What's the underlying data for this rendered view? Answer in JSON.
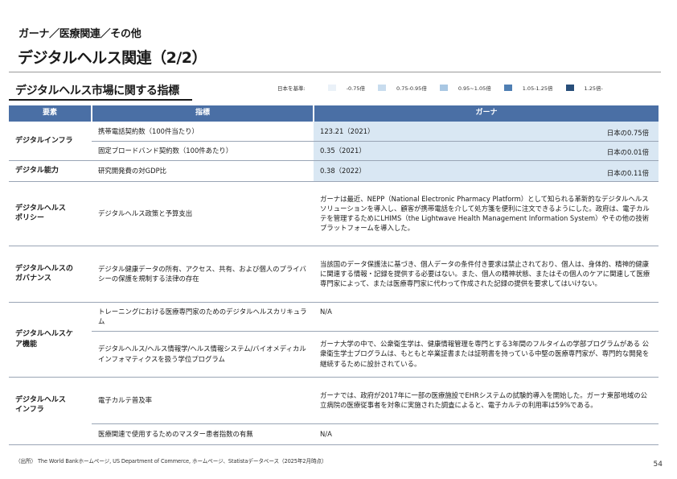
{
  "header": {
    "breadcrumb": "ガーナ／医療関連／その他",
    "title": "デジタルヘルス関連（2/2）",
    "subtitle": "デジタルヘルス市場に関する指標"
  },
  "legend": {
    "label": "日本を基準:",
    "items": [
      {
        "label": "-0.75倍",
        "color": "#eaf1f8"
      },
      {
        "label": "0.75-0.95倍",
        "color": "#c8dcee"
      },
      {
        "label": "0.95~1.05倍",
        "color": "#a9c7e3"
      },
      {
        "label": "1.05-1.25倍",
        "color": "#4f7fb3"
      },
      {
        "label": "1.25倍-",
        "color": "#284e7a"
      }
    ]
  },
  "table": {
    "headers": [
      "要素",
      "指標",
      "ガーナ"
    ],
    "rows": [
      {
        "factor": "デジタルインフラ",
        "indicator": "携帯電話契約数（100件当たり）",
        "ghana": "123.21（2021）",
        "ratio": "日本の0.75倍"
      },
      {
        "indicator": "固定ブロードバンド契約数（100件あたり）",
        "ghana": "0.35（2021）",
        "ratio": "日本の0.01倍"
      },
      {
        "factor": "デジタル能力",
        "indicator": "研究開発費の対GDP比",
        "ghana": "0.38（2022）",
        "ratio": "日本の0.11倍"
      },
      {
        "factor": "デジタルヘルス\nポリシー",
        "indicator": "デジタルヘルス政策と予算支出",
        "ghana": "ガーナは最近、NEPP（National Electronic Pharmacy Platform）として知られる革新的なデジタルヘルスソリューションを導入し、顧客が携帯電話を介して処方箋を便利に注文できるようにした。政府は、電子カルテを管理するためにLHIMS（the Lightwave Health Management Information System）やその他の技術プラットフォームを導入した。"
      },
      {
        "factor": "デジタルヘルスの\nガバナンス",
        "indicator": "デジタル健康データの所有、アクセス、共有、および個人のプライバシーの保護を規制する法律の存在",
        "ghana": "当該国のデータ保護法に基づき、個人データの条件付き要求は禁止されており、個人は、身体的、精神的健康に関連する情報・記録を提供する必要はない。また、個人の精神状態、またはその個人のケアに関連して医療専門家によって、または医療専門家に代わって作成された記録の提供を要求してはいけない。"
      },
      {
        "factor": "デジタルヘルスケ\nア機能",
        "indicator": "トレーニングにおける医療専門家のためのデジタルヘルスカリキュラム",
        "ghana": "N/A"
      },
      {
        "indicator": "デジタルヘルス/ヘルス情報学/ヘルス情報システム/バイオメディカルインフォマティクスを扱う学位プログラム",
        "ghana": "ガーナ大学の中で、公衆衛生学は、健康情報管理を専門とする3年間のフルタイムの学部プログラムがある 公衆衛生学士プログラムは、もともと卒業証書または証明書を持っている中堅の医療専門家が、専門的な開発を継続するために設計されている。"
      },
      {
        "factor": "デジタルヘルス\nインフラ",
        "indicator": "電子カルテ普及率",
        "ghana": "ガーナでは、政府が2017年に一部の医療施設でEHRシステムの試験的導入を開始した。ガーナ東部地域の公立病院の医療従事者を対象に実施された調査によると、電子カルテの利用率は59%である。"
      },
      {
        "indicator": "医療関連で使用するためのマスター患者指数の有無",
        "ghana": "N/A"
      }
    ]
  },
  "footer": {
    "source": "（出所） The World Bankホームページ, US Department of Commerce, ホームページ、Statistaデータベース（2025年2月時点）",
    "page_number": "54"
  }
}
